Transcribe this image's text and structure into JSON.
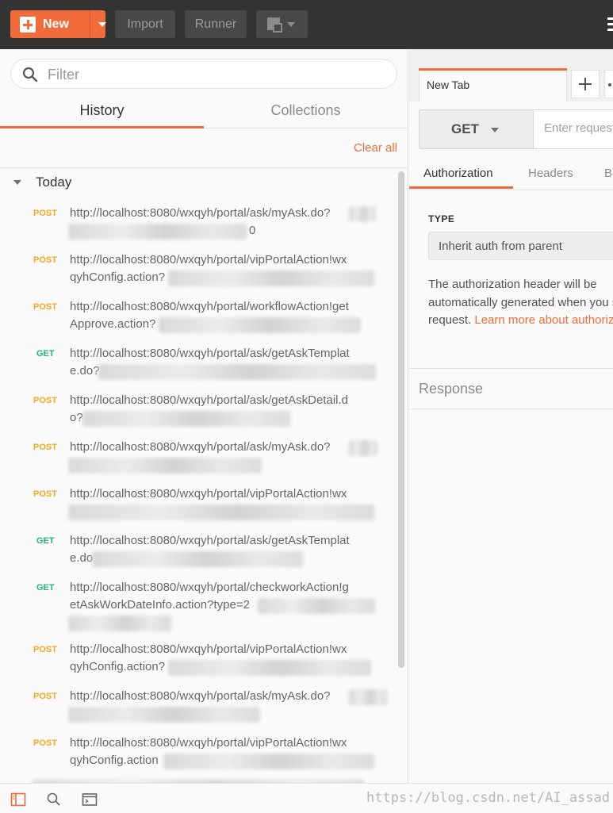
{
  "toolbar": {
    "new_label": "New",
    "import_label": "Import",
    "runner_label": "Runner",
    "new_window_icon": "new-window-icon"
  },
  "sidebar": {
    "filter_placeholder": "Filter",
    "tabs": [
      {
        "label": "History",
        "active": true
      },
      {
        "label": "Collections",
        "active": false
      }
    ],
    "clear_all_label": "Clear all",
    "group_label": "Today",
    "items": [
      {
        "method": "POST",
        "line1": "http://localhost:8080/wxqyh/portal/ask/myAsk.do?",
        "line2": "0"
      },
      {
        "method": "POST",
        "line1": "http://localhost:8080/wxqyh/portal/vipPortalAction!wx",
        "line2": "qyhConfig.action?"
      },
      {
        "method": "POST",
        "line1": "http://localhost:8080/wxqyh/portal/workflowAction!get",
        "line2": "Approve.action?"
      },
      {
        "method": "GET",
        "line1": "http://localhost:8080/wxqyh/portal/ask/getAskTemplat",
        "line2": "e.do?"
      },
      {
        "method": "POST",
        "line1": "http://localhost:8080/wxqyh/portal/ask/getAskDetail.d",
        "line2": "o?"
      },
      {
        "method": "POST",
        "line1": "http://localhost:8080/wxqyh/portal/ask/myAsk.do?",
        "line2": ""
      },
      {
        "method": "POST",
        "line1": "http://localhost:8080/wxqyh/portal/vipPortalAction!wx",
        "line2": ""
      },
      {
        "method": "GET",
        "line1": "http://localhost:8080/wxqyh/portal/ask/getAskTemplat",
        "line2": "e.do"
      },
      {
        "method": "GET",
        "line1": "http://localhost:8080/wxqyh/portal/checkworkAction!g",
        "line2": "etAskWorkDateInfo.action?type=2"
      },
      {
        "method": "POST",
        "line1": "http://localhost:8080/wxqyh/portal/vipPortalAction!wx",
        "line2": "qyhConfig.action?"
      },
      {
        "method": "POST",
        "line1": "http://localhost:8080/wxqyh/portal/ask/myAsk.do?",
        "line2": ""
      },
      {
        "method": "POST",
        "line1": "http://localhost:8080/wxqyh/portal/vipPortalAction!wx",
        "line2": "qyhConfig.action"
      }
    ]
  },
  "request": {
    "tab_label": "New Tab",
    "method": "GET",
    "url_placeholder": "Enter request URL",
    "subtabs": [
      "Authorization",
      "Headers",
      "Body"
    ],
    "type_label": "TYPE",
    "auth_type": "Inherit auth from parent",
    "auth_desc_line1": "The authorization header will be",
    "auth_desc_line2": "automatically generated when you send the",
    "auth_desc_line3": "request. ",
    "auth_link": "Learn more about authorization",
    "response_label": "Response"
  },
  "statusbar": {
    "watermark": "https://blog.csdn.net/AI_assad"
  },
  "colors": {
    "accent": "#f26b3a",
    "post": "#f5a623",
    "get": "#26b47f",
    "toolbar_bg": "#333333"
  }
}
